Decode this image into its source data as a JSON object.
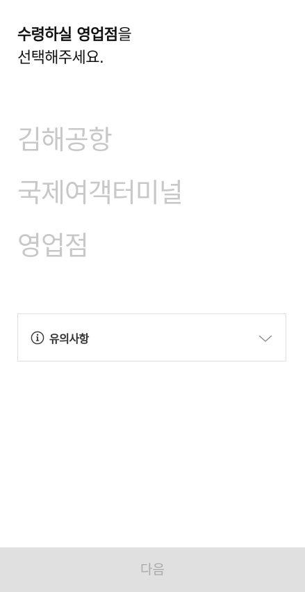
{
  "heading": {
    "line1_bold": "수령하실 영업점",
    "line1_rest": "을",
    "line2": "선택해주세요."
  },
  "branches": [
    {
      "label": "김해공항"
    },
    {
      "label": "국제여객터미널"
    },
    {
      "label": "영업점"
    }
  ],
  "notice": {
    "label": "유의사항",
    "icon": "info-icon",
    "toggle_icon": "chevron-down-icon"
  },
  "footer": {
    "next_label": "다음"
  },
  "colors": {
    "option_text": "#c8c8c8",
    "button_bg": "#e0e0e0",
    "button_text": "#a9a9a9",
    "border": "#dedede"
  }
}
